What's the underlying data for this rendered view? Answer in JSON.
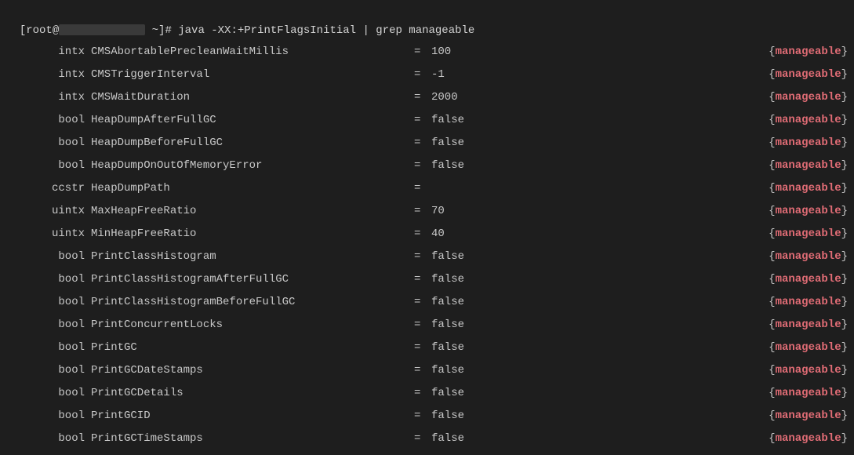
{
  "prompt": {
    "user": "root",
    "path_prefix": "[root@",
    "path_suffix": " ~]# ",
    "command": "java -XX:+PrintFlagsInitial | grep manageable"
  },
  "attr_label": "manageable",
  "rows": [
    {
      "type": "intx",
      "name": "CMSAbortablePrecleanWaitMillis",
      "value": "100"
    },
    {
      "type": "intx",
      "name": "CMSTriggerInterval",
      "value": "-1"
    },
    {
      "type": "intx",
      "name": "CMSWaitDuration",
      "value": "2000"
    },
    {
      "type": "bool",
      "name": "HeapDumpAfterFullGC",
      "value": "false"
    },
    {
      "type": "bool",
      "name": "HeapDumpBeforeFullGC",
      "value": "false"
    },
    {
      "type": "bool",
      "name": "HeapDumpOnOutOfMemoryError",
      "value": "false"
    },
    {
      "type": "ccstr",
      "name": "HeapDumpPath",
      "value": ""
    },
    {
      "type": "uintx",
      "name": "MaxHeapFreeRatio",
      "value": "70"
    },
    {
      "type": "uintx",
      "name": "MinHeapFreeRatio",
      "value": "40"
    },
    {
      "type": "bool",
      "name": "PrintClassHistogram",
      "value": "false"
    },
    {
      "type": "bool",
      "name": "PrintClassHistogramAfterFullGC",
      "value": "false"
    },
    {
      "type": "bool",
      "name": "PrintClassHistogramBeforeFullGC",
      "value": "false"
    },
    {
      "type": "bool",
      "name": "PrintConcurrentLocks",
      "value": "false"
    },
    {
      "type": "bool",
      "name": "PrintGC",
      "value": "false"
    },
    {
      "type": "bool",
      "name": "PrintGCDateStamps",
      "value": "false"
    },
    {
      "type": "bool",
      "name": "PrintGCDetails",
      "value": "false"
    },
    {
      "type": "bool",
      "name": "PrintGCID",
      "value": "false"
    },
    {
      "type": "bool",
      "name": "PrintGCTimeStamps",
      "value": "false"
    }
  ]
}
